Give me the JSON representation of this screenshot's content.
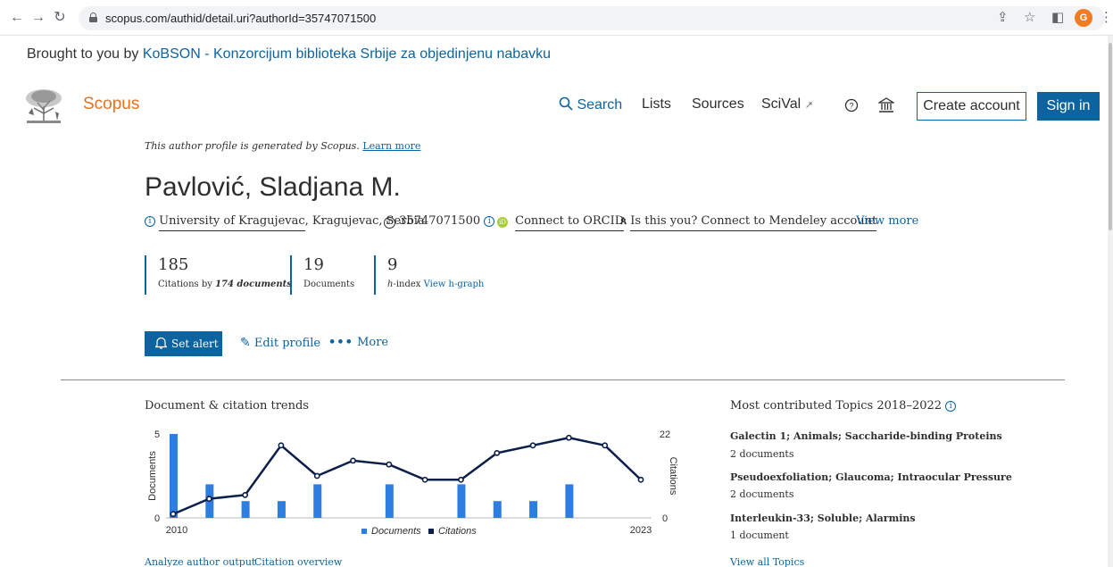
{
  "browser": {
    "url": "scopus.com/authid/detail.uri?authorId=35747071500",
    "avatar_letter": "G",
    "avatar_color": "#f37c22"
  },
  "banner": {
    "prefix": "Brought to you by ",
    "institution": "KoBSON - Konzorcijum biblioteka Srbije za objedinjenu nabavku"
  },
  "header": {
    "brand": "Scopus",
    "nav": {
      "search": "Search",
      "lists": "Lists",
      "sources": "Sources",
      "scival": "SciVal"
    },
    "create_account": "Create account",
    "sign_in": "Sign in"
  },
  "profile": {
    "note": "This author profile is generated by Scopus.",
    "learn_more": "Learn more",
    "name": "Pavlović, Sladjana M.",
    "affiliation_link": "University of Kragujevac",
    "affiliation_rest": ", Kragujevac, Serbia",
    "scopus_id": "35747071500",
    "connect_orcid": "Connect to ORCID",
    "mendeley": "Is this you? Connect to Mendeley account",
    "view_more": "View more"
  },
  "metrics": {
    "citations": {
      "value": "185",
      "label_prefix": "Citations by ",
      "label_bold": "174 documents"
    },
    "documents": {
      "value": "19",
      "label": "Documents"
    },
    "h_index": {
      "value": "9",
      "label_prefix": "h",
      "label_rest": "-index",
      "link": "View h-graph"
    }
  },
  "actions": {
    "set_alert": "Set alert",
    "edit_profile": "Edit profile",
    "more": "More"
  },
  "chart_data": {
    "type": "bar",
    "title": "Document & citation trends",
    "x": [
      2010,
      2011,
      2012,
      2013,
      2014,
      2015,
      2016,
      2017,
      2018,
      2019,
      2020,
      2021,
      2022,
      2023
    ],
    "xtick_labels": [
      "2010",
      "2023"
    ],
    "left_axis": {
      "label": "Documents",
      "ticks": [
        "5",
        "0"
      ],
      "ylim": [
        0,
        5
      ]
    },
    "right_axis": {
      "label": "Citations",
      "ticks": [
        "22",
        "0"
      ],
      "ylim": [
        0,
        22
      ]
    },
    "series": [
      {
        "name": "Documents",
        "kind": "bar",
        "color": "#2e7de1",
        "values": [
          5,
          2,
          1,
          1,
          2,
          0,
          2,
          0,
          2,
          1,
          1,
          2,
          0,
          0
        ]
      },
      {
        "name": "Citations",
        "kind": "line",
        "color": "#0c1e4a",
        "values": [
          1,
          5,
          6,
          19,
          11,
          15,
          14,
          10,
          10,
          17,
          19,
          21,
          19,
          10
        ]
      }
    ]
  },
  "chart_links": {
    "analyze": "Analyze author output",
    "citation_overview": "Citation overview"
  },
  "topics": {
    "title": "Most contributed Topics 2018–2022",
    "items": [
      {
        "name": "Galectin 1; Animals; Saccharide-binding Proteins",
        "docs": "2 documents"
      },
      {
        "name": "Pseudoexfoliation; Glaucoma; Intraocular Pressure",
        "docs": "2 documents"
      },
      {
        "name": "Interleukin-33; Soluble; Alarmins",
        "docs": "1 document"
      }
    ],
    "view_all": "View all Topics"
  }
}
